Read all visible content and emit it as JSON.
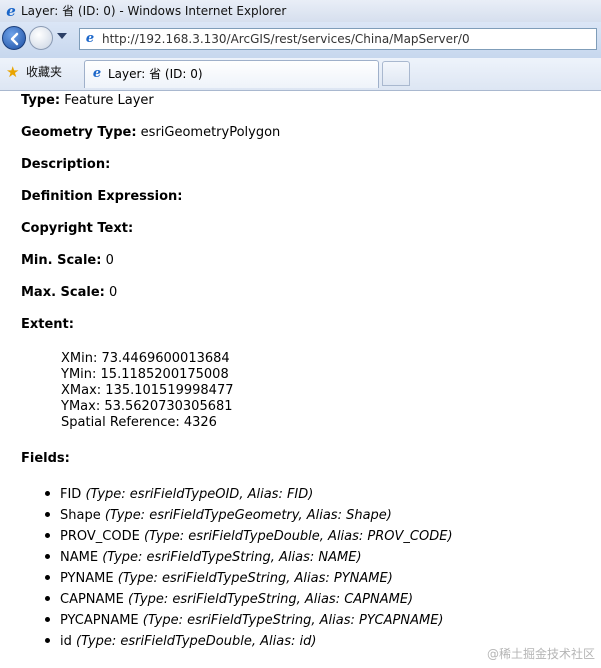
{
  "window": {
    "title": "Layer: 省 (ID: 0) - Windows Internet Explorer"
  },
  "navbar": {
    "url": "http://192.168.3.130/ArcGIS/rest/services/China/MapServer/0"
  },
  "favorites": {
    "label": "收藏夹"
  },
  "tab": {
    "label": "Layer: 省 (ID: 0)"
  },
  "layer": {
    "type_label": "Type:",
    "type_value": "Feature Layer",
    "geometry_label": "Geometry Type:",
    "geometry_value": "esriGeometryPolygon",
    "description_label": "Description:",
    "definition_label": "Definition Expression:",
    "copyright_label": "Copyright Text:",
    "minscale_label": "Min. Scale:",
    "minscale_value": "0",
    "maxscale_label": "Max. Scale:",
    "maxscale_value": "0",
    "extent_label": "Extent:",
    "extent": [
      "XMin: 73.4469600013684",
      "YMin: 15.1185200175008",
      "XMax: 135.101519998477",
      "YMax: 53.5620730305681",
      "Spatial Reference: 4326"
    ],
    "fields_label": "Fields:",
    "fields": [
      {
        "name": "FID",
        "meta": "(Type: esriFieldTypeOID, Alias: FID)"
      },
      {
        "name": "Shape",
        "meta": "(Type: esriFieldTypeGeometry, Alias: Shape)"
      },
      {
        "name": "PROV_CODE",
        "meta": "(Type: esriFieldTypeDouble, Alias: PROV_CODE)"
      },
      {
        "name": "NAME",
        "meta": "(Type: esriFieldTypeString, Alias: NAME)"
      },
      {
        "name": "PYNAME",
        "meta": "(Type: esriFieldTypeString, Alias: PYNAME)"
      },
      {
        "name": "CAPNAME",
        "meta": "(Type: esriFieldTypeString, Alias: CAPNAME)"
      },
      {
        "name": "PYCAPNAME",
        "meta": "(Type: esriFieldTypeString, Alias: PYCAPNAME)"
      },
      {
        "name": "id",
        "meta": "(Type: esriFieldTypeDouble, Alias: id)"
      }
    ]
  },
  "watermark": "@稀土掘金技术社区"
}
